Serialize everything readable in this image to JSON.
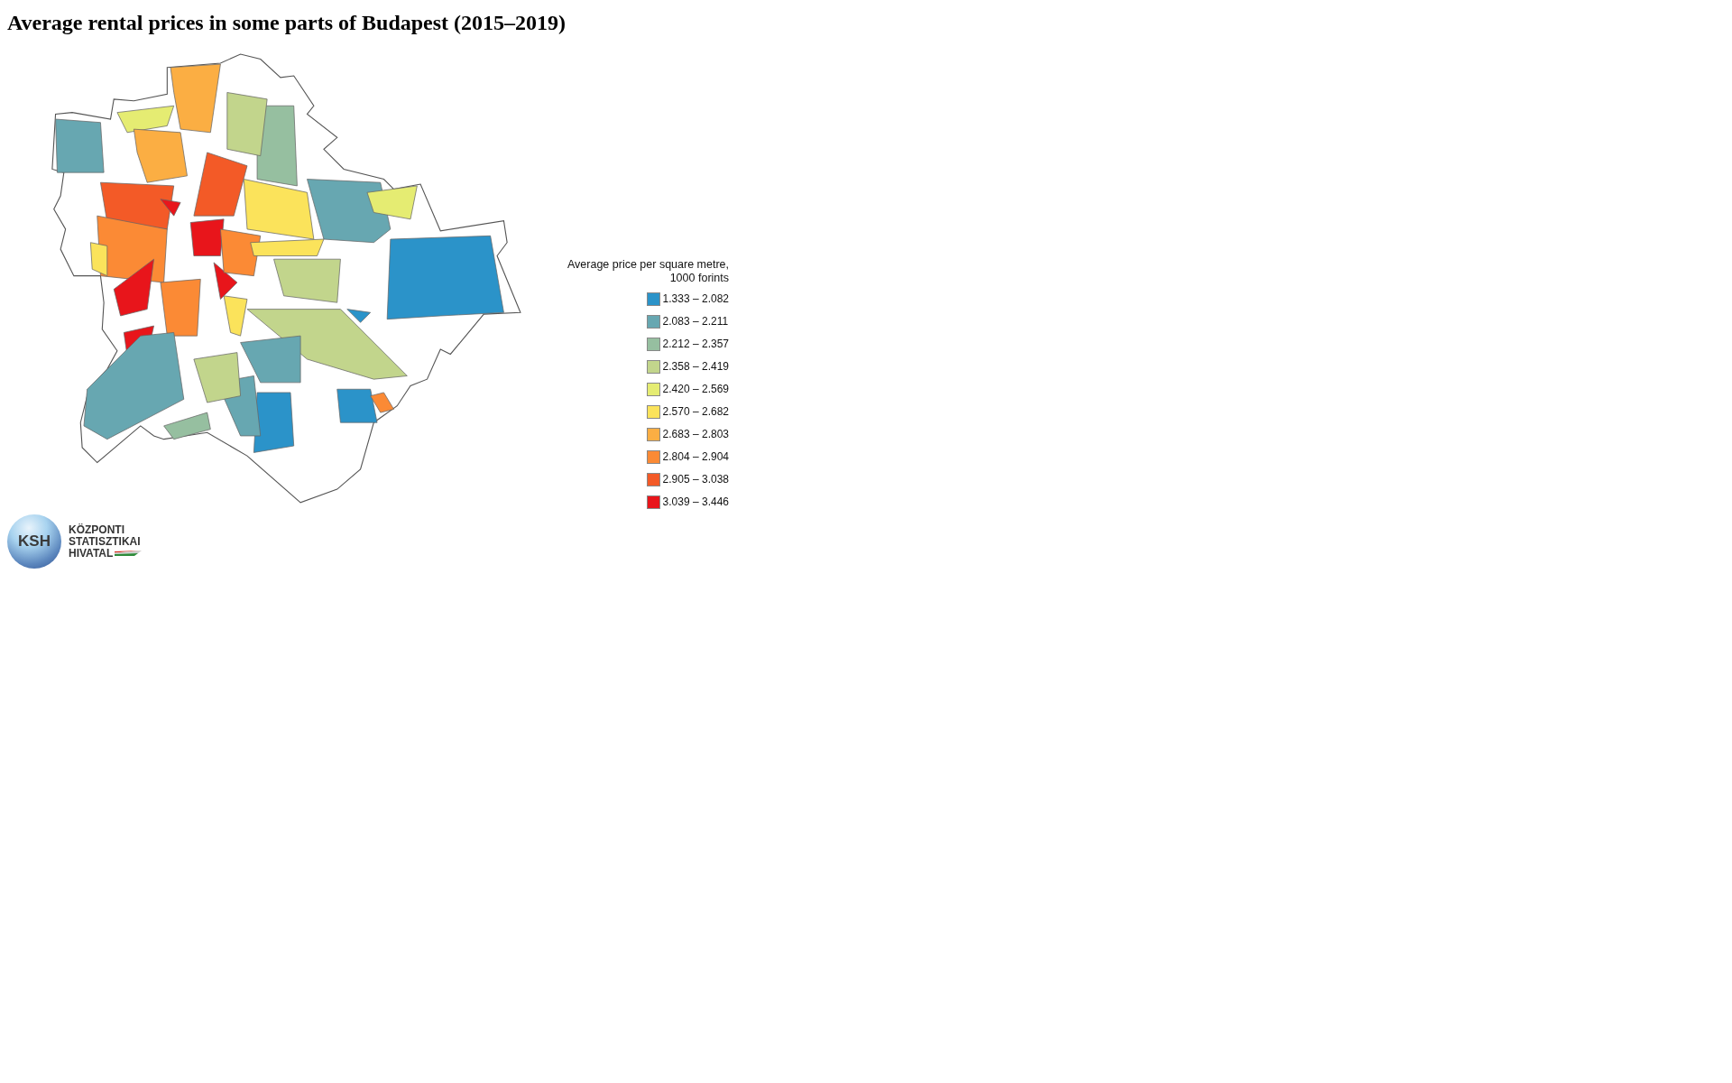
{
  "title": "Average rental prices in some parts of Budapest (2015–2019)",
  "legend": {
    "title": "Average price per square metre,",
    "subtitle": "1000 forints",
    "items": [
      {
        "label": "1.333 – 2.082",
        "color": "#2b93c9"
      },
      {
        "label": "2.083 – 2.211",
        "color": "#67a7b1"
      },
      {
        "label": "2.212 – 2.357",
        "color": "#96bfa0"
      },
      {
        "label": "2.358 – 2.419",
        "color": "#c2d58c"
      },
      {
        "label": "2.420 – 2.569",
        "color": "#e5ec72"
      },
      {
        "label": "2.570 – 2.682",
        "color": "#fbe35b"
      },
      {
        "label": "2.683 – 2.803",
        "color": "#fbae43"
      },
      {
        "label": "2.804 – 2.904",
        "color": "#fb8a35"
      },
      {
        "label": "2.905 – 3.038",
        "color": "#f35a27"
      },
      {
        "label": "3.039 – 3.446",
        "color": "#e8151b"
      }
    ]
  },
  "logo": {
    "initials": "KSH",
    "lines": [
      "KÖZPONTI",
      "STATISZTIKAI",
      "HIVATAL"
    ]
  }
}
